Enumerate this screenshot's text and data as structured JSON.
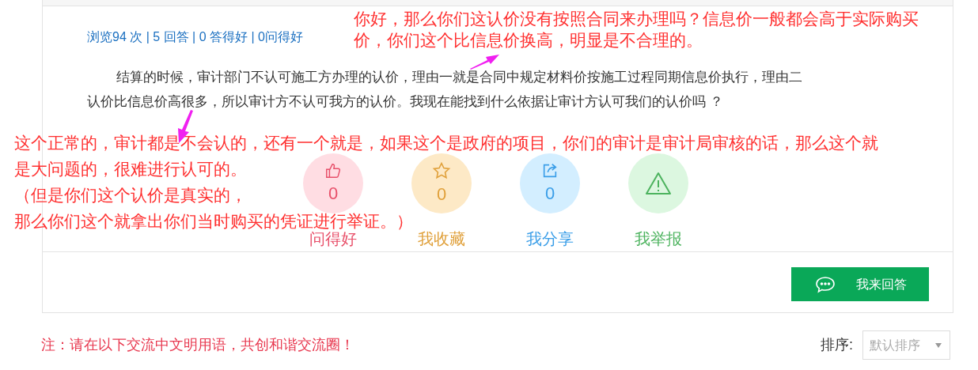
{
  "question": {
    "stats": "浏览94 次 | 5 回答 | 0 答得好 | 0问得好",
    "text": "结算的时候，审计部门不认可施工方办理的认价，理由一就是合同中规定材料价按施工过程同期信息价执行，理由二认价比信息价高很多，所以审计方不认可我方的认价。我现在能找到什么依据让审计方认可我们的认价吗 ？"
  },
  "actions": [
    {
      "kind": "thumb",
      "count": "0",
      "label": "问得好",
      "color": "#e8506a"
    },
    {
      "kind": "star",
      "count": "0",
      "label": "我收藏",
      "color": "#e0a03a"
    },
    {
      "kind": "share",
      "count": "0",
      "label": "我分享",
      "color": "#3a9ee8"
    },
    {
      "kind": "warning",
      "label": "我举报",
      "color": "#4cb35e"
    }
  ],
  "answer_button": "我来回答",
  "note": "注：请在以下交流中文明用语，共创和谐交流圈！",
  "sort": {
    "label": "排序:",
    "value": "默认排序"
  },
  "annotations": [
    {
      "lines": [
        "你好，那么你们这认价没有按照合同来办理吗？信息价一般都会高于实际购买",
        "价，你们这个比信息价换高，明显是不合理的。"
      ]
    },
    {
      "lines": [
        "这个正常的，审计都是不会认的，还有一个就是，如果这个是政府的项目，你们的审计是审计局审核的话，那么这个就",
        "是大问题的，很难进行认可的。",
        "（但是你们这个认价是真实的，",
        "那么你们这个就拿出你们当时购买的凭证进行举证。）"
      ]
    }
  ]
}
